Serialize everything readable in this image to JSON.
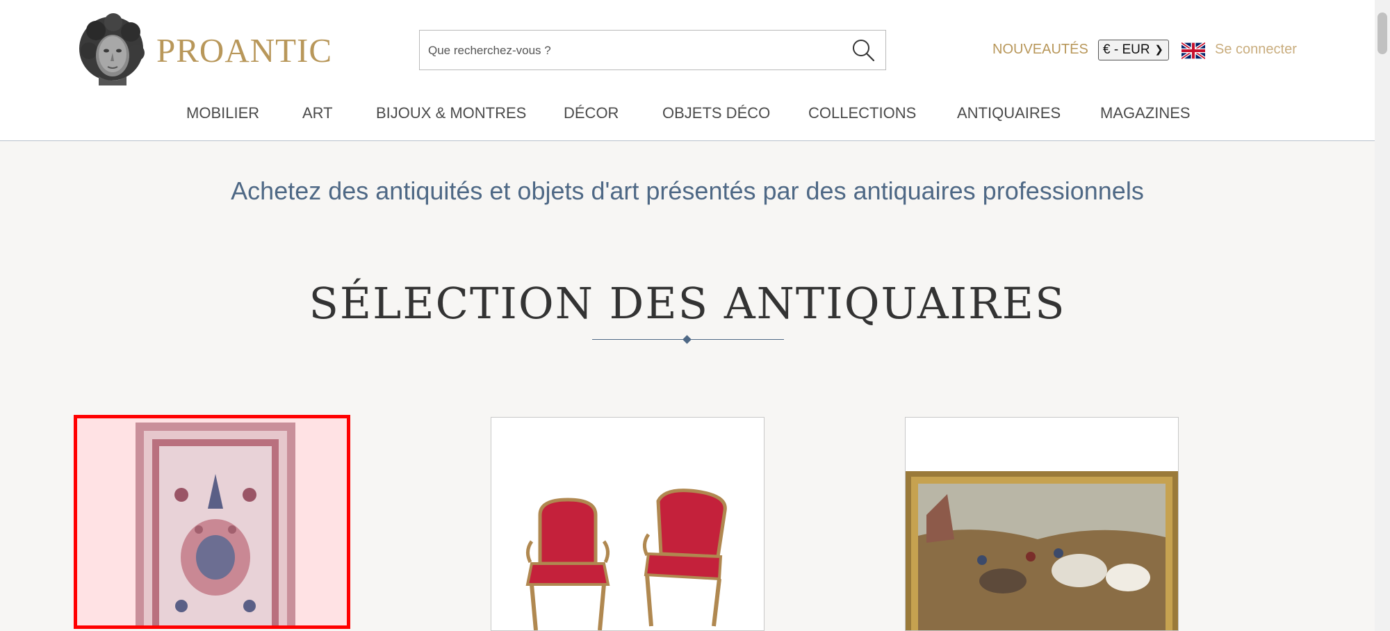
{
  "header": {
    "brand": "PROANTIC",
    "search": {
      "placeholder": "Que recherchez-vous ?"
    },
    "nouveautes": "NOUVEAUTÉS",
    "currency": "€ - EUR",
    "login": "Se connecter"
  },
  "nav": {
    "items": [
      {
        "label": "MOBILIER"
      },
      {
        "label": "ART"
      },
      {
        "label": "BIJOUX & MONTRES"
      },
      {
        "label": "DÉCOR"
      },
      {
        "label": "OBJETS DÉCO"
      },
      {
        "label": "COLLECTIONS"
      },
      {
        "label": "ANTIQUAIRES"
      },
      {
        "label": "MAGAZINES"
      }
    ]
  },
  "main": {
    "tagline": "Achetez des antiquités et objets d'art présentés par des antiquaires professionnels",
    "selection_title": "SÉLECTION DES ANTIQUAIRES"
  },
  "colors": {
    "brand_gold": "#b8975a",
    "accent_blue": "#4e6885",
    "selection_red": "#ff0000"
  },
  "icons": [
    "sculpture-head-logo",
    "search-icon",
    "uk-flag-icon",
    "chevron-down-icon"
  ]
}
